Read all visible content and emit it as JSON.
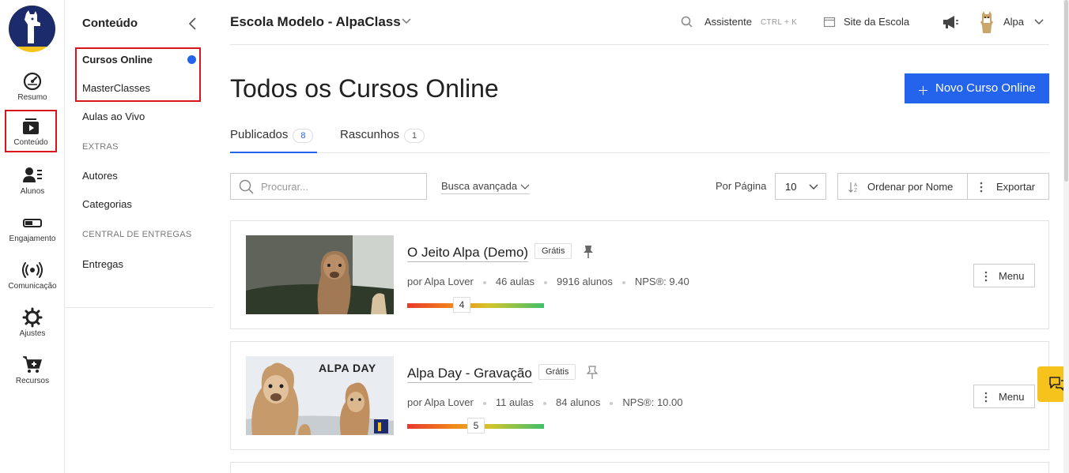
{
  "rail": {
    "items": [
      {
        "label": "Resumo",
        "icon": "gauge-icon"
      },
      {
        "label": "Conteúdo",
        "icon": "video-stack-icon"
      },
      {
        "label": "Alunos",
        "icon": "users-icon"
      },
      {
        "label": "Engajamento",
        "icon": "toggle-icon"
      },
      {
        "label": "Comunicação",
        "icon": "broadcast-icon"
      },
      {
        "label": "Ajustes",
        "icon": "gear-icon"
      },
      {
        "label": "Recursos",
        "icon": "cart-plus-icon"
      }
    ]
  },
  "sidebar": {
    "title": "Conteúdo",
    "items": {
      "cursos": "Cursos Online",
      "masterclasses": "MasterClasses",
      "aulas": "Aulas ao Vivo",
      "extras_section": "EXTRAS",
      "autores": "Autores",
      "categorias": "Categorias",
      "central_section": "CENTRAL DE ENTREGAS",
      "entregas": "Entregas"
    }
  },
  "header": {
    "school": "Escola Modelo - AlpaClass",
    "assistant": "Assistente",
    "assistant_shortcut": "CTRL + K",
    "site": "Site da Escola",
    "user": "Alpa"
  },
  "main": {
    "title": "Todos os Cursos Online",
    "new_button": "Novo Curso Online",
    "tabs": [
      {
        "label": "Publicados",
        "count": "8"
      },
      {
        "label": "Rascunhos",
        "count": "1"
      }
    ],
    "search_placeholder": "Procurar...",
    "advanced_search": "Busca avançada",
    "per_page_label": "Por Página",
    "per_page_value": "10",
    "order_label": "Ordenar por Nome",
    "export_label": "Exportar"
  },
  "courses": [
    {
      "title": "O Jeito Alpa (Demo)",
      "badge": "Grátis",
      "author": "por Alpa Lover",
      "lessons": "46 aulas",
      "students": "9916 alunos",
      "nps": "NPS®: 9.40",
      "score": "4",
      "score_fraction": 0.4,
      "menu": "Menu"
    },
    {
      "title": "Alpa Day - Gravação",
      "badge": "Grátis",
      "author": "por Alpa Lover",
      "lessons": "11 aulas",
      "students": "84 alunos",
      "nps": "NPS®: 10.00",
      "score": "5",
      "score_fraction": 0.5,
      "menu": "Menu",
      "thumb_text": "ALPA DAY"
    }
  ],
  "colors": {
    "accent": "#2463eb",
    "highlight": "#d8141c",
    "brand_yellow": "#f6c21c",
    "brand_navy": "#1b2b6b"
  }
}
